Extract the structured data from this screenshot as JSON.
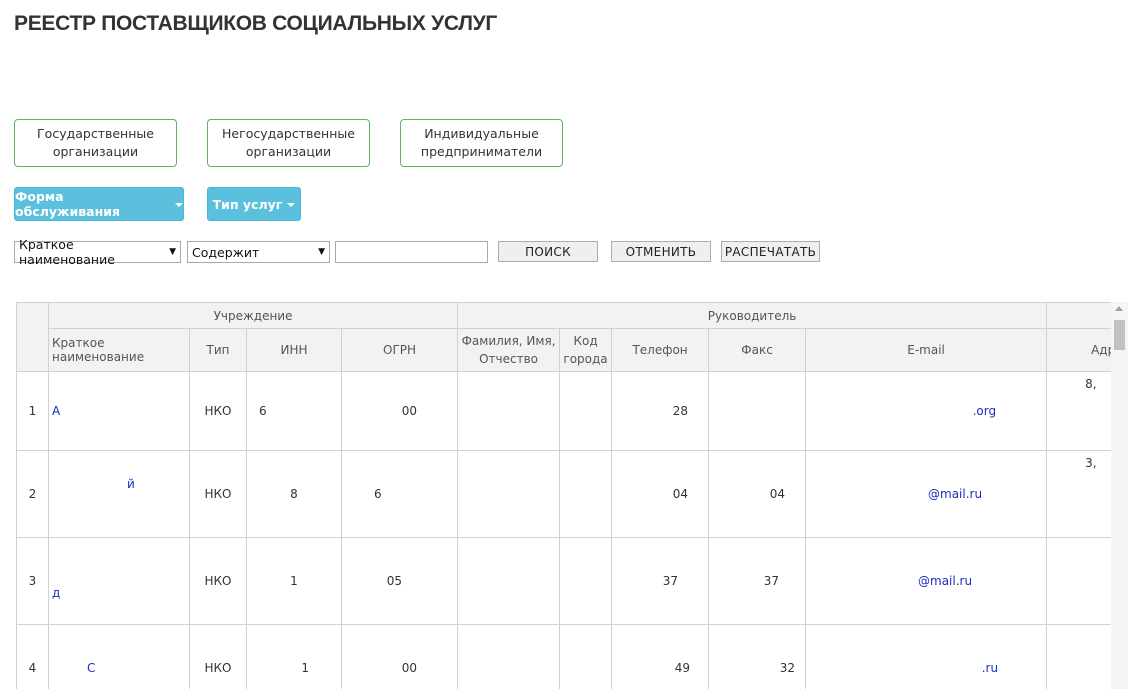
{
  "page": {
    "title": "РЕЕСТР ПОСТАВЩИКОВ СОЦИАЛЬНЫХ УСЛУГ"
  },
  "org_types": [
    {
      "label": "Государственные организации"
    },
    {
      "label": "Негосударственные организации"
    },
    {
      "label": "Индивидуальные предприниматели"
    }
  ],
  "dropdowns": {
    "service_form": "Форма обслуживания",
    "service_type": "Тип услуг"
  },
  "filter": {
    "field_select": "Краткое наименование",
    "condition_select": "Содержит",
    "value": "",
    "search_button": "ПОИСК",
    "cancel_button": "ОТМЕНИТЬ",
    "print_button": "РАСПЕЧАТАТЬ"
  },
  "table": {
    "group_headers": {
      "institution": "Учреждение",
      "head": "Руководитель",
      "address": "Адр"
    },
    "columns": {
      "short_name": "Краткое наименование",
      "type": "Тип",
      "inn": "ИНН",
      "ogrn": "ОГРН",
      "full_name": "Фамилия, Имя, Отчество",
      "city_code": "Код города",
      "phone": "Телефон",
      "fax": "Факс",
      "email": "E-mail"
    },
    "rows": [
      {
        "n": "1",
        "name": "А",
        "type": "НКО",
        "inn": "6",
        "ogrn": "00",
        "fio": "",
        "code": "",
        "phone": "28",
        "fax": "",
        "email": ".org",
        "addr": "8,"
      },
      {
        "n": "2",
        "name": "й",
        "type": "НКО",
        "inn": "8",
        "ogrn": "6",
        "fio": "",
        "code": "",
        "phone": "04",
        "fax": "04",
        "email": "@mail.ru",
        "addr": "3,"
      },
      {
        "n": "3",
        "name": "д",
        "type": "НКО",
        "inn": "1",
        "ogrn": "05",
        "fio": "",
        "code": "",
        "phone": "37",
        "fax": "37",
        "email": "@mail.ru",
        "addr": ""
      },
      {
        "n": "4",
        "name": "С",
        "type": "НКО",
        "inn": "1",
        "ogrn": "00",
        "fio": "",
        "code": "",
        "phone": "49",
        "fax": "32",
        "email": ".ru",
        "addr": ""
      }
    ]
  }
}
